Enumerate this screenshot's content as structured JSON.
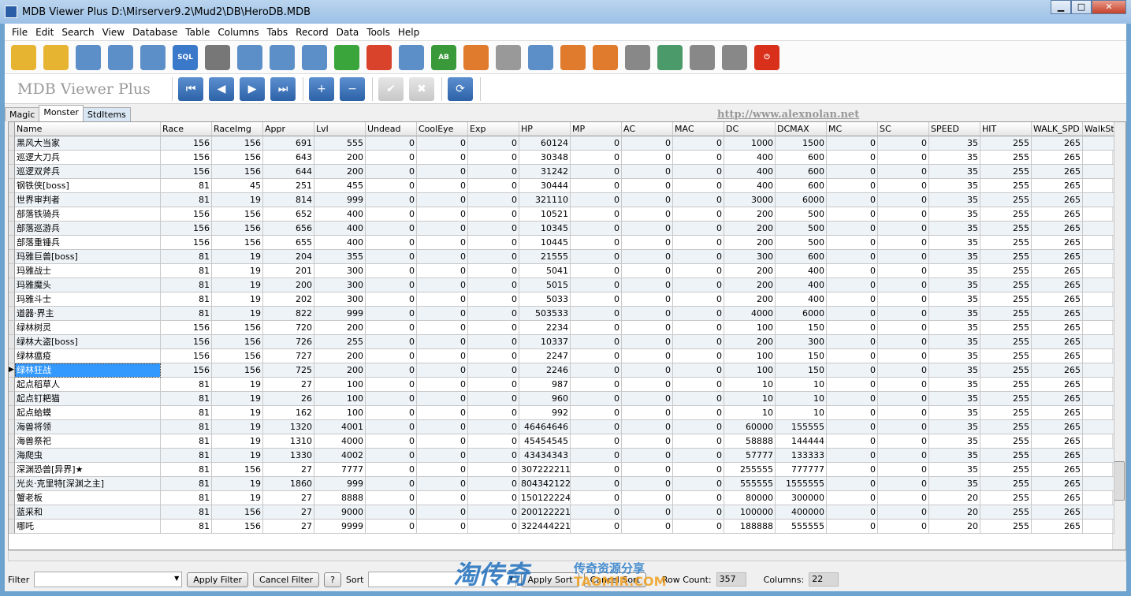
{
  "window": {
    "title": "MDB Viewer Plus D:\\Mirserver9.2\\Mud2\\DB\\HeroDB.MDB",
    "minimize": "▁",
    "maximize": "□",
    "close": "✕"
  },
  "menu": [
    "File",
    "Edit",
    "Search",
    "View",
    "Database",
    "Table",
    "Columns",
    "Tabs",
    "Record",
    "Data",
    "Tools",
    "Help"
  ],
  "toolbar": [
    {
      "icon": "open-folder-icon",
      "color": "#e7b432"
    },
    {
      "icon": "open-recent-icon",
      "color": "#e7b432"
    },
    {
      "icon": "table-view-icon",
      "color": "#5c8fc8"
    },
    {
      "icon": "query-icon",
      "color": "#5c8fc8"
    },
    {
      "icon": "search-db-icon",
      "color": "#5c8fc8"
    },
    {
      "icon": "sql-icon",
      "color": "#3a78c9",
      "text": "SQL"
    },
    {
      "icon": "database-add-icon",
      "color": "#777"
    },
    {
      "icon": "tables-icon",
      "color": "#5c8fc8"
    },
    {
      "icon": "columns-icon",
      "color": "#5c8fc8"
    },
    {
      "icon": "table-info-icon",
      "color": "#5c8fc8"
    },
    {
      "icon": "add-record-icon",
      "color": "#3aa53a"
    },
    {
      "icon": "delete-record-icon",
      "color": "#d9432c"
    },
    {
      "icon": "edit-record-icon",
      "color": "#5c8fc8"
    },
    {
      "icon": "rename-icon",
      "color": "#3a9a3a",
      "text": "AB"
    },
    {
      "icon": "export-icon",
      "color": "#e07a2c"
    },
    {
      "icon": "settings-icon",
      "color": "#999"
    },
    {
      "icon": "resize-columns-icon",
      "color": "#5c8fc8"
    },
    {
      "icon": "add-column-icon",
      "color": "#e07a2c"
    },
    {
      "icon": "remove-column-icon",
      "color": "#e07a2c"
    },
    {
      "icon": "print-icon",
      "color": "#888"
    },
    {
      "icon": "compact-db-icon",
      "color": "#4a9a6a"
    },
    {
      "icon": "import-icon",
      "color": "#888"
    },
    {
      "icon": "export-db-icon",
      "color": "#888"
    },
    {
      "icon": "power-icon",
      "color": "#d9301c",
      "text": "⏻"
    }
  ],
  "nav": {
    "brand": "MDB Viewer Plus",
    "url": "http://www.alexnolan.net",
    "first": "⏮",
    "prev": "◀",
    "next": "▶",
    "last": "⏭",
    "add": "+",
    "remove": "−",
    "post": "✔",
    "cancel": "✖",
    "refresh": "⟳"
  },
  "tabs": [
    "Magic",
    "Monster",
    "StdItems"
  ],
  "table": {
    "columns": [
      "Name",
      "Race",
      "RaceImg",
      "Appr",
      "Lvl",
      "Undead",
      "CoolEye",
      "Exp",
      "HP",
      "MP",
      "AC",
      "MAC",
      "DC",
      "DCMAX",
      "MC",
      "SC",
      "SPEED",
      "HIT",
      "WALK_SPD",
      "WalkSt"
    ],
    "selected_row": 16,
    "rows": [
      [
        "黑风大当家",
        156,
        156,
        691,
        555,
        0,
        0,
        0,
        60124,
        0,
        0,
        0,
        1000,
        1500,
        0,
        0,
        35,
        255,
        265,
        ""
      ],
      [
        "巡逻大刀兵",
        156,
        156,
        643,
        200,
        0,
        0,
        0,
        30348,
        0,
        0,
        0,
        400,
        600,
        0,
        0,
        35,
        255,
        265,
        ""
      ],
      [
        "巡逻双斧兵",
        156,
        156,
        644,
        200,
        0,
        0,
        0,
        31242,
        0,
        0,
        0,
        400,
        600,
        0,
        0,
        35,
        255,
        265,
        ""
      ],
      [
        "钢铁侠[boss]",
        81,
        45,
        251,
        455,
        0,
        0,
        0,
        30444,
        0,
        0,
        0,
        400,
        600,
        0,
        0,
        35,
        255,
        265,
        ""
      ],
      [
        "世界审判者",
        81,
        19,
        814,
        999,
        0,
        0,
        0,
        321110,
        0,
        0,
        0,
        3000,
        6000,
        0,
        0,
        35,
        255,
        265,
        ""
      ],
      [
        "部落铁骑兵",
        156,
        156,
        652,
        400,
        0,
        0,
        0,
        10521,
        0,
        0,
        0,
        200,
        500,
        0,
        0,
        35,
        255,
        265,
        ""
      ],
      [
        "部落巡游兵",
        156,
        156,
        656,
        400,
        0,
        0,
        0,
        10345,
        0,
        0,
        0,
        200,
        500,
        0,
        0,
        35,
        255,
        265,
        ""
      ],
      [
        "部落重锤兵",
        156,
        156,
        655,
        400,
        0,
        0,
        0,
        10445,
        0,
        0,
        0,
        200,
        500,
        0,
        0,
        35,
        255,
        265,
        ""
      ],
      [
        "玛雅巨兽[boss]",
        81,
        19,
        204,
        355,
        0,
        0,
        0,
        21555,
        0,
        0,
        0,
        300,
        600,
        0,
        0,
        35,
        255,
        265,
        ""
      ],
      [
        "玛雅战士",
        81,
        19,
        201,
        300,
        0,
        0,
        0,
        5041,
        0,
        0,
        0,
        200,
        400,
        0,
        0,
        35,
        255,
        265,
        ""
      ],
      [
        "玛雅魔头",
        81,
        19,
        200,
        300,
        0,
        0,
        0,
        5015,
        0,
        0,
        0,
        200,
        400,
        0,
        0,
        35,
        255,
        265,
        ""
      ],
      [
        "玛雅斗士",
        81,
        19,
        202,
        300,
        0,
        0,
        0,
        5033,
        0,
        0,
        0,
        200,
        400,
        0,
        0,
        35,
        255,
        265,
        ""
      ],
      [
        "道器·界主",
        81,
        19,
        822,
        999,
        0,
        0,
        0,
        503533,
        0,
        0,
        0,
        4000,
        6000,
        0,
        0,
        35,
        255,
        265,
        ""
      ],
      [
        "绿林树灵",
        156,
        156,
        720,
        200,
        0,
        0,
        0,
        2234,
        0,
        0,
        0,
        100,
        150,
        0,
        0,
        35,
        255,
        265,
        ""
      ],
      [
        "绿林大盗[boss]",
        156,
        156,
        726,
        255,
        0,
        0,
        0,
        10337,
        0,
        0,
        0,
        200,
        300,
        0,
        0,
        35,
        255,
        265,
        ""
      ],
      [
        "绿林瘟疫",
        156,
        156,
        727,
        200,
        0,
        0,
        0,
        2247,
        0,
        0,
        0,
        100,
        150,
        0,
        0,
        35,
        255,
        265,
        ""
      ],
      [
        "绿林狂战",
        156,
        156,
        725,
        200,
        0,
        0,
        0,
        2246,
        0,
        0,
        0,
        100,
        150,
        0,
        0,
        35,
        255,
        265,
        ""
      ],
      [
        "起点稻草人",
        81,
        19,
        27,
        100,
        0,
        0,
        0,
        987,
        0,
        0,
        0,
        10,
        10,
        0,
        0,
        35,
        255,
        265,
        ""
      ],
      [
        "起点钉耙猫",
        81,
        19,
        26,
        100,
        0,
        0,
        0,
        960,
        0,
        0,
        0,
        10,
        10,
        0,
        0,
        35,
        255,
        265,
        ""
      ],
      [
        "起点蛤蟆",
        81,
        19,
        162,
        100,
        0,
        0,
        0,
        992,
        0,
        0,
        0,
        10,
        10,
        0,
        0,
        35,
        255,
        265,
        ""
      ],
      [
        "海兽将领",
        81,
        19,
        1320,
        4001,
        0,
        0,
        0,
        46464646,
        0,
        0,
        0,
        60000,
        155555,
        0,
        0,
        35,
        255,
        265,
        ""
      ],
      [
        "海兽祭祀",
        81,
        19,
        1310,
        4000,
        0,
        0,
        0,
        45454545,
        0,
        0,
        0,
        58888,
        144444,
        0,
        0,
        35,
        255,
        265,
        ""
      ],
      [
        "海爬虫",
        81,
        19,
        1330,
        4002,
        0,
        0,
        0,
        43434343,
        0,
        0,
        0,
        57777,
        133333,
        0,
        0,
        35,
        255,
        265,
        ""
      ],
      [
        "深渊恐兽[异界]★",
        81,
        156,
        27,
        7777,
        0,
        0,
        0,
        307222211,
        0,
        0,
        0,
        255555,
        777777,
        0,
        0,
        35,
        255,
        265,
        ""
      ],
      [
        "光炎·克里特[深渊之主]",
        81,
        19,
        1860,
        999,
        0,
        0,
        0,
        804342122,
        0,
        0,
        0,
        555555,
        1555555,
        0,
        0,
        35,
        255,
        265,
        ""
      ],
      [
        "蟹老板",
        81,
        19,
        27,
        8888,
        0,
        0,
        0,
        150122224,
        0,
        0,
        0,
        80000,
        300000,
        0,
        0,
        20,
        255,
        265,
        ""
      ],
      [
        "蓝采和",
        81,
        156,
        27,
        9000,
        0,
        0,
        0,
        200122221,
        0,
        0,
        0,
        100000,
        400000,
        0,
        0,
        20,
        255,
        265,
        ""
      ],
      [
        "哪吒",
        81,
        156,
        27,
        9999,
        0,
        0,
        0,
        322444221,
        0,
        0,
        0,
        188888,
        555555,
        0,
        0,
        20,
        255,
        265,
        ""
      ]
    ]
  },
  "status": {
    "filter_label": "Filter",
    "filter_value": "",
    "apply_filter": "Apply Filter",
    "cancel_filter": "Cancel Filter",
    "help": "?",
    "sort_label": "Sort",
    "sort_value": "",
    "apply_sort": "Apply Sort",
    "cancel_sort": "Cancel Sort",
    "row_count_label": "Row Count:",
    "row_count": "357",
    "columns_label": "Columns:",
    "columns": "22"
  },
  "watermark": {
    "main": "淘传奇",
    "sub": "传奇资源分享",
    "domain": "TAOMIR.COM"
  }
}
